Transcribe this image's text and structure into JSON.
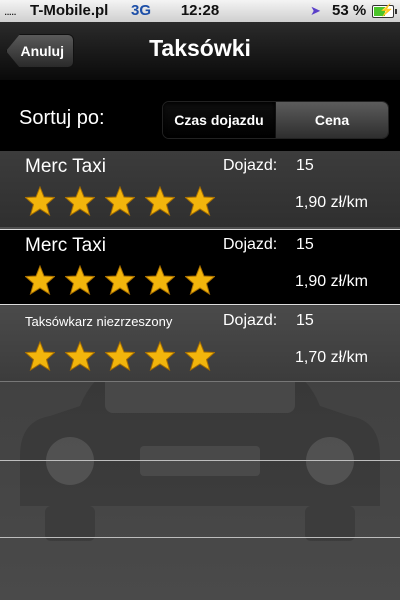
{
  "status": {
    "signal": ".....",
    "carrier": "T-Mobile.pl",
    "network": "3G",
    "time": "12:28",
    "battery": "53 %"
  },
  "nav": {
    "back_label": "Anuluj",
    "title": "Taksówki"
  },
  "sort": {
    "label": "Sortuj po:",
    "options": [
      "Czas dojazdu",
      "Cena"
    ],
    "selected": "Czas dojazdu"
  },
  "rows": [
    {
      "name": "Merc Taxi",
      "dojazd_label": "Dojazd:",
      "dojazd_value": "15",
      "price": "1,90 zł/km",
      "rating": 5
    },
    {
      "name": "Merc Taxi",
      "dojazd_label": "Dojazd:",
      "dojazd_value": "15",
      "price": "1,90 zł/km",
      "rating": 5
    },
    {
      "name": "Taksówkarz niezrzeszony",
      "dojazd_label": "Dojazd:",
      "dojazd_value": "15",
      "price": "1,70 zł/km",
      "rating": 5
    }
  ],
  "colors": {
    "star": "#f2b50c",
    "network": "#1d4fa8",
    "battery": "#4bc52a"
  }
}
